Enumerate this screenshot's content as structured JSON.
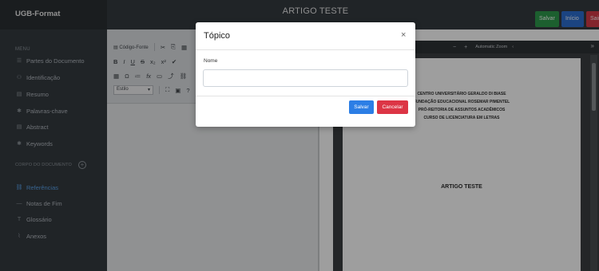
{
  "app": {
    "brand": "UGB-Format",
    "document_title": "ARTIGO TESTE"
  },
  "header": {
    "save_label": "Salvar",
    "home_label": "Início",
    "exit_label": "Sair"
  },
  "sidebar": {
    "menu_label": "MENU",
    "items": [
      {
        "label": "Partes do Documento",
        "icon": "list-icon"
      },
      {
        "label": "Identificação",
        "icon": "user-icon"
      },
      {
        "label": "Resumo",
        "icon": "document-icon"
      },
      {
        "label": "Palavras-chave",
        "icon": "key-icon"
      },
      {
        "label": "Abstract",
        "icon": "document-icon"
      },
      {
        "label": "Keywords",
        "icon": "key-icon"
      }
    ],
    "section_label": "CORPO DO DOCUMENTO",
    "section_items": [
      {
        "label": "Referências",
        "icon": "link-icon",
        "active": true
      },
      {
        "label": "Notas de Fim",
        "icon": "dash-icon"
      },
      {
        "label": "Glossário",
        "icon": "text-icon"
      },
      {
        "label": "Anexos",
        "icon": "paperclip-icon"
      }
    ]
  },
  "editor": {
    "source_label": "Código-Fonte",
    "style_label": "Estilo"
  },
  "viewer": {
    "zoom_label": "Automatic Zoom",
    "header_lines": [
      "CENTRO UNIVERSITÁRIO GERALDO DI BIASE",
      "FUNDAÇÃO EDUCACIONAL ROSEMAR PIMENTEL",
      "PRÓ-REITORIA DE ASSUNTOS ACADÊMICOS",
      "CURSO DE LICENCIATURA EM LETRAS"
    ],
    "page_title": "ARTIGO TESTE"
  },
  "modal": {
    "title": "Tópico",
    "field_label": "Nome",
    "field_value": "",
    "save_label": "Salvar",
    "cancel_label": "Cancelar"
  }
}
